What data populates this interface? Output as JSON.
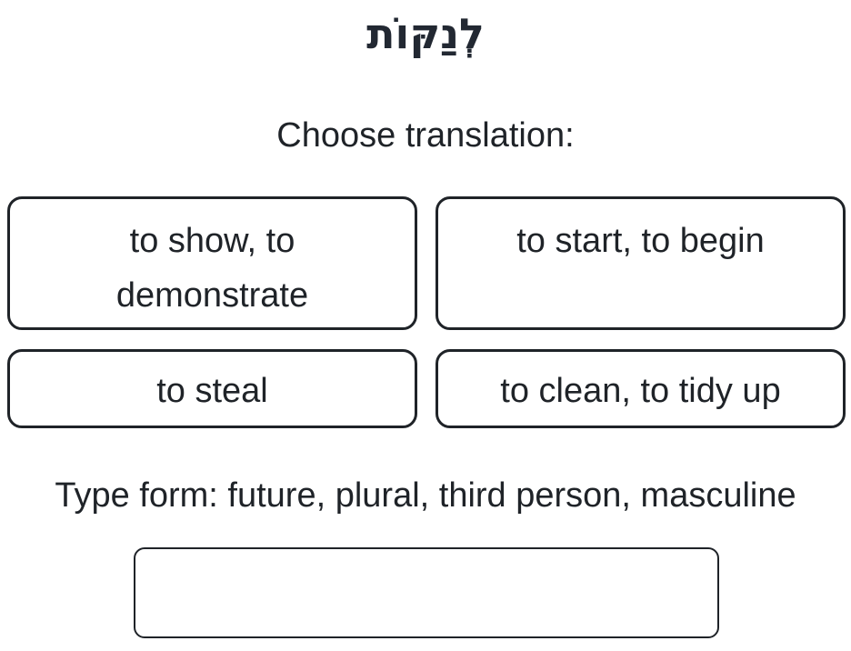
{
  "quiz": {
    "word": "לְנַקּוֹת",
    "choose_prompt": "Choose translation:",
    "options": [
      {
        "label": "to show, to demonstrate"
      },
      {
        "label": "to start, to begin"
      },
      {
        "label": "to steal"
      },
      {
        "label": "to clean, to tidy up"
      }
    ],
    "form_prompt": "Type form: future, plural, third person, masculine",
    "answer_input": {
      "value": "",
      "placeholder": ""
    }
  }
}
